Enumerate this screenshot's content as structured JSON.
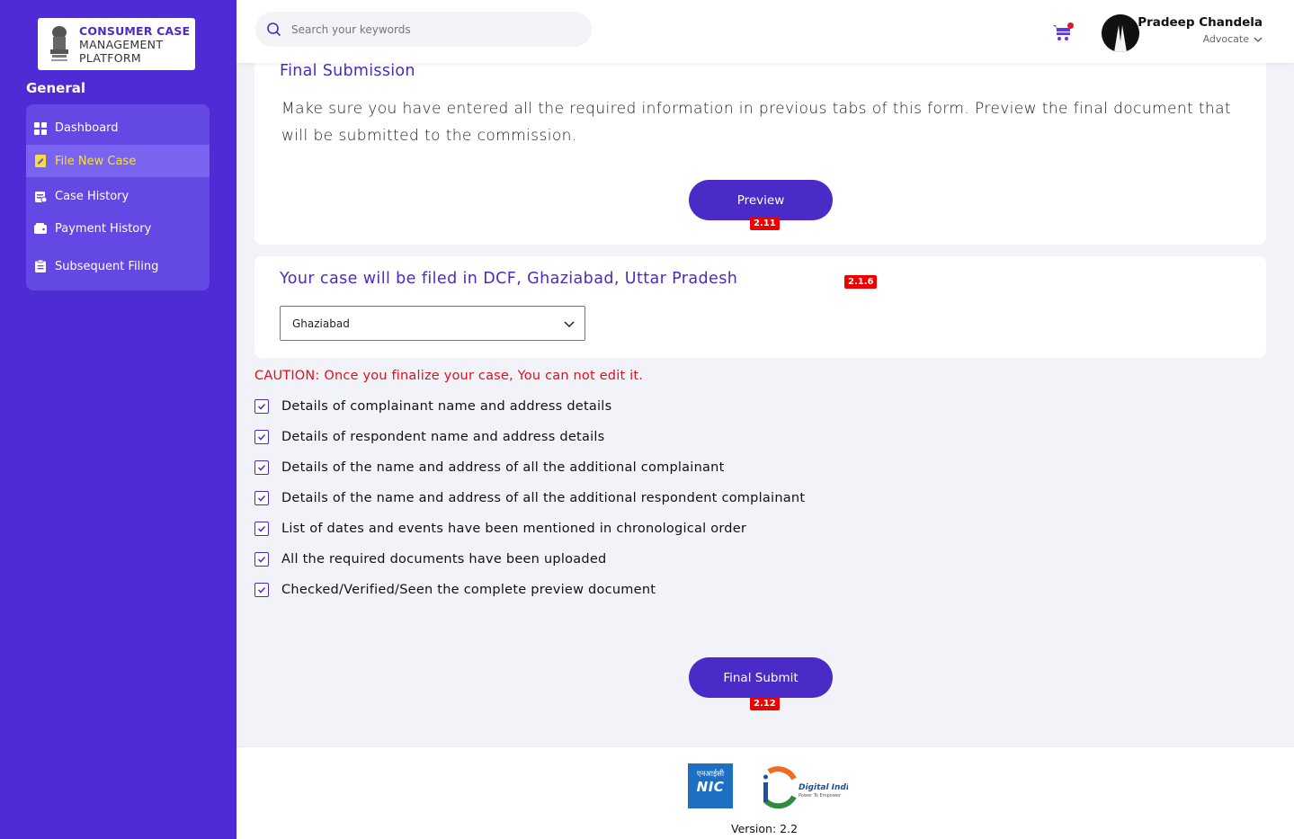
{
  "app": {
    "logo_line1": "CONSUMER CASE",
    "logo_line2": "MANAGEMENT",
    "logo_line3": "PLATFORM"
  },
  "sidebar": {
    "section_title": "General",
    "items": [
      {
        "label": "Dashboard",
        "icon": "grid-icon",
        "active": false
      },
      {
        "label": "File New Case",
        "icon": "file-edit-icon",
        "active": true
      },
      {
        "label": "Case History",
        "icon": "history-icon",
        "active": false
      },
      {
        "label": "Payment History",
        "icon": "wallet-icon",
        "active": false
      },
      {
        "label": "Subsequent Filing",
        "icon": "clipboard-icon",
        "active": false
      }
    ]
  },
  "header": {
    "search_placeholder": "Search your keywords",
    "user_name": "Pradeep Chandela",
    "user_role": "Advocate"
  },
  "final_submission": {
    "title": "Final Submission",
    "description": "Make sure you have entered all the required information in previous tabs of this form. Preview the final document that will be submitted to the commission.",
    "preview_label": "Preview",
    "preview_tag": "2.11"
  },
  "filing": {
    "title": "Your case will be filed in DCF, Ghaziabad, Uttar Pradesh",
    "tag": "2.1.6",
    "selected_district": "Ghaziabad"
  },
  "caution": "CAUTION: Once you finalize your case, You can not edit it.",
  "checklist": [
    {
      "label": "Details of complainant name and address details",
      "checked": true
    },
    {
      "label": "Details of respondent name and address details",
      "checked": true
    },
    {
      "label": "Details of the name and address of all the additional complainant",
      "checked": true
    },
    {
      "label": "Details of the name and address of all the additional respondent complainant",
      "checked": true
    },
    {
      "label": "List of dates and events have been mentioned in chronological order",
      "checked": true
    },
    {
      "label": "All the required documents have been uploaded",
      "checked": true
    },
    {
      "label": "Checked/Verified/Seen the complete preview document",
      "checked": true
    }
  ],
  "final_submit": {
    "label": "Final Submit",
    "tag": "2.12"
  },
  "footer": {
    "nic_hindi": "एनआईसी",
    "nic_text": "NIC",
    "digital_india": "Digital India",
    "digital_india_tagline": "Power To Empower",
    "version": "Version: 2.2"
  },
  "colors": {
    "sidebar": "#4f2bd6",
    "accent": "#4a2bc8",
    "caution": "#e30f1a",
    "active_text": "#f5e03a"
  }
}
